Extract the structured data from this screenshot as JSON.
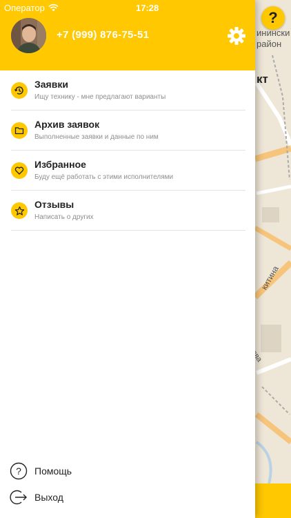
{
  "status_bar": {
    "carrier": "Оператор",
    "time": "17:28"
  },
  "profile": {
    "phone": "+7 (999) 876-75-51"
  },
  "menu": [
    {
      "title": "Заявки",
      "subtitle": "Ищу технику - мне предлагают варианты",
      "icon": "clock-icon"
    },
    {
      "title": "Архив заявок",
      "subtitle": "Выполненные заявки и данные по ним",
      "icon": "folder-icon"
    },
    {
      "title": "Избранное",
      "subtitle": "Буду ещё работать с этими исполнителями",
      "icon": "heart-icon"
    },
    {
      "title": "Отзывы",
      "subtitle": "Написать о других",
      "icon": "star-icon"
    }
  ],
  "bottom": {
    "help_label": "Помощь",
    "exit_label": "Выход"
  },
  "map": {
    "labels": [
      "инински",
      "район",
      "кт",
      "китина",
      "вва"
    ],
    "help_glyph": "?"
  },
  "colors": {
    "accent": "#ffc800",
    "text": "#222222",
    "subtext": "#8e8e8e"
  }
}
